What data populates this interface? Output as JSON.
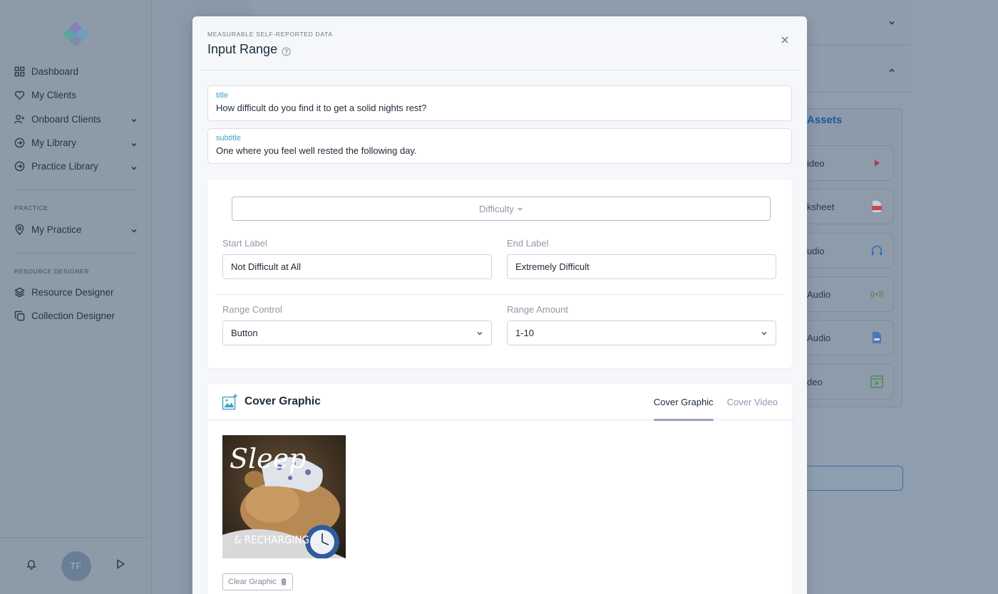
{
  "sidebar": {
    "items": [
      {
        "label": "Dashboard",
        "icon": "grid-icon",
        "has_chevron": false
      },
      {
        "label": "My Clients",
        "icon": "heart-icon",
        "has_chevron": false
      },
      {
        "label": "Onboard Clients",
        "icon": "user-plus-icon",
        "has_chevron": true
      },
      {
        "label": "My Library",
        "icon": "arrow-circle-icon",
        "has_chevron": true
      },
      {
        "label": "Practice Library",
        "icon": "arrow-circle-icon",
        "has_chevron": true
      }
    ],
    "practice_section": "PRACTICE",
    "practice_items": [
      {
        "label": "My Practice",
        "icon": "map-pin-icon",
        "has_chevron": true
      }
    ],
    "resource_section": "RESOURCE DESIGNER",
    "resource_items": [
      {
        "label": "Resource Designer",
        "icon": "layers-icon"
      },
      {
        "label": "Collection Designer",
        "icon": "copy-icon"
      }
    ],
    "avatar_initials": "TF"
  },
  "background": {
    "assets_title": "Assets",
    "assets": [
      {
        "label": "ideo",
        "icon": "play-icon"
      },
      {
        "label": "ksheet",
        "icon": "pdf-icon"
      },
      {
        "label": "udio",
        "icon": "ai-headphones-icon"
      },
      {
        "label": "Audio",
        "icon": "broadcast-icon"
      },
      {
        "label": "Audio",
        "icon": "audio-file-icon"
      },
      {
        "label": "deo",
        "icon": "video-frame-icon"
      }
    ]
  },
  "modal": {
    "eyebrow": "MEASURABLE SELF-REPORTED DATA",
    "title": "Input Range",
    "title_field": {
      "label": "title",
      "value": "How difficult do you find it to get a solid nights rest?"
    },
    "subtitle_field": {
      "label": "subtitle",
      "value": "One where you feel well rested the following day."
    },
    "scale_dropdown": "Difficulty",
    "start_label": {
      "label": "Start Label",
      "value": "Not Difficult at All"
    },
    "end_label": {
      "label": "End Label",
      "value": "Extremely Difficult"
    },
    "range_control": {
      "label": "Range Control",
      "value": "Button"
    },
    "range_amount": {
      "label": "Range Amount",
      "value": "1-10"
    },
    "cover": {
      "title": "Cover Graphic",
      "tabs": [
        "Cover Graphic",
        "Cover Video"
      ],
      "active_tab": "Cover Graphic",
      "image_text_1": "Sleep",
      "image_text_2": "& RECHARGING",
      "clear_button": "Clear Graphic"
    }
  },
  "colors": {
    "accent_teal": "#3ea3c9",
    "tab_underline": "#a79bc2",
    "overlay": "#8f9eae"
  }
}
